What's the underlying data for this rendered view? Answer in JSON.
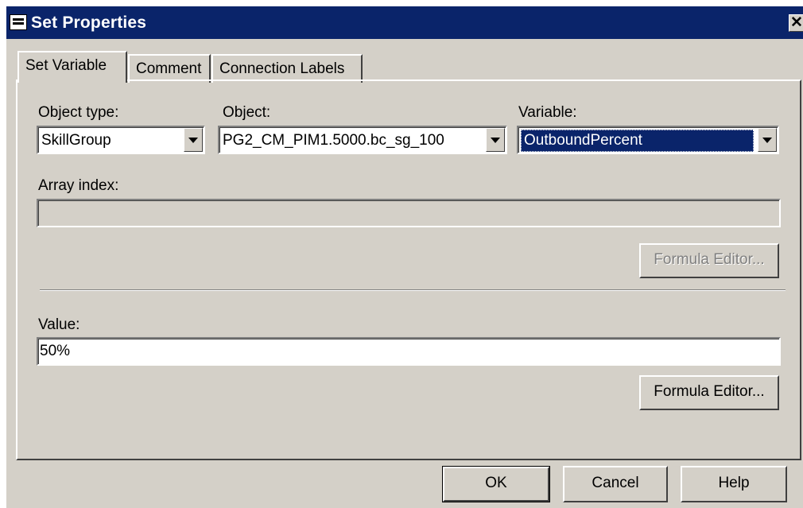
{
  "window": {
    "title": "Set Properties",
    "close_glyph": "✕"
  },
  "tabs": [
    {
      "label": "Set Variable",
      "active": true
    },
    {
      "label": "Comment",
      "active": false
    },
    {
      "label": "Connection Labels",
      "active": false
    }
  ],
  "form": {
    "object_type": {
      "label": "Object type:",
      "value": "SkillGroup"
    },
    "object": {
      "label": "Object:",
      "value": "PG2_CM_PIM1.5000.bc_sg_100"
    },
    "variable": {
      "label": "Variable:",
      "value": "OutboundPercent"
    },
    "array_index": {
      "label": "Array index:",
      "value": ""
    },
    "array_formula_button": "Formula Editor...",
    "value": {
      "label": "Value:",
      "value": "50%"
    },
    "value_formula_button": "Formula Editor..."
  },
  "buttons": {
    "ok": "OK",
    "cancel": "Cancel",
    "help": "Help"
  }
}
